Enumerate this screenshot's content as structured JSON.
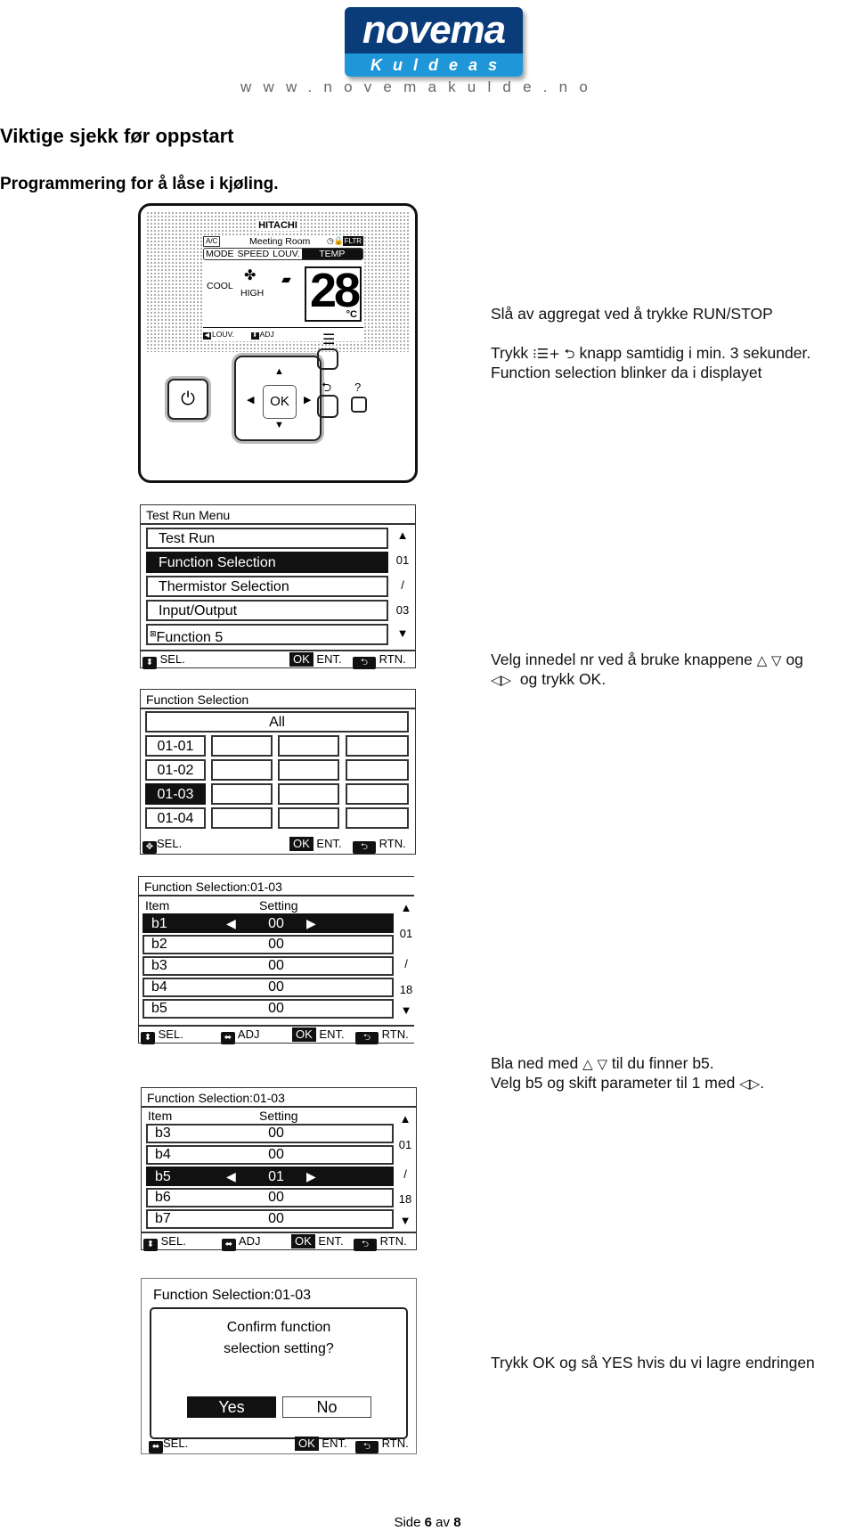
{
  "logo": {
    "brand": "novema",
    "sub": "Kuldeas",
    "url": "www.novemakulde.no",
    "colors": {
      "dark_blue": "#0b3c7a",
      "light_blue": "#1e96d8"
    }
  },
  "heading": "Viktige sjekk før oppstart",
  "subheading": "Programmering for å låse i kjøling.",
  "instructions": {
    "step1_line1": "Slå av aggregat ved å trykke RUN/STOP",
    "step1_line2_pre": "Trykk",
    "step1_line2_icons": "⁝☰+ ⮌",
    "step1_line2_post": "knapp samtidig i min. 3 sekunder.",
    "step1_line3": "Function selection blinker da i displayet",
    "step2_line1_pre": "Velg innedel nr ved å bruke knappene",
    "step2_updown": "△ ▽",
    "step2_line1_post": "og",
    "step2_leftright": "◁▷",
    "step2_line2_post": "og trykk OK.",
    "step3_line1_pre": "Bla ned med",
    "step3_updown": "△ ▽",
    "step3_line1_post": "til du finner b5.",
    "step3_line2_pre": "Velg b5 og skift parameter til 1 med",
    "step3_leftright": "◁▷",
    "step3_line2_post": ".",
    "step4": "Trykk OK og så YES hvis du vi lagre endringen"
  },
  "remote": {
    "brand": "HITACHI",
    "ac_tag": "A/C",
    "room": "Meeting Room",
    "filter_tag": "FLTR",
    "tabs": [
      "MODE",
      "SPEED",
      "LOUV.",
      "TEMP"
    ],
    "active_tab": "TEMP",
    "mode": "COOL",
    "speed": "HIGH",
    "temperature": "28",
    "unit": "°C",
    "footer_left": "LOUV.",
    "footer_right": "ADJ",
    "ok_label": "OK",
    "help_label": "?"
  },
  "screen_test_run": {
    "title": "Test Run Menu",
    "items": [
      "Test Run",
      "Function Selection",
      "Thermistor Selection",
      "Input/Output",
      "Function 5"
    ],
    "selected_index": 1,
    "page_current": "01",
    "page_sep": "/",
    "page_total": "03",
    "footer": {
      "sel": "SEL.",
      "ok": "OK",
      "ent": "ENT.",
      "rtn": "RTN."
    }
  },
  "screen_function_selection": {
    "title": "Function Selection",
    "all_label": "All",
    "units": [
      "01-01",
      "01-02",
      "01-03",
      "01-04"
    ],
    "selected_index": 2,
    "footer": {
      "sel": "SEL.",
      "ok": "OK",
      "ent": "ENT.",
      "rtn": "RTN."
    }
  },
  "screen_settings_a": {
    "title": "Function Selection:01-03",
    "col_item": "Item",
    "col_setting": "Setting",
    "rows": [
      {
        "item": "b1",
        "value": "00"
      },
      {
        "item": "b2",
        "value": "00"
      },
      {
        "item": "b3",
        "value": "00"
      },
      {
        "item": "b4",
        "value": "00"
      },
      {
        "item": "b5",
        "value": "00"
      }
    ],
    "selected_index": 0,
    "page_current": "01",
    "page_sep": "/",
    "page_total": "18",
    "footer": {
      "sel": "SEL.",
      "adj": "ADJ",
      "ok": "OK",
      "ent": "ENT.",
      "rtn": "RTN."
    }
  },
  "screen_settings_b": {
    "title": "Function Selection:01-03",
    "col_item": "Item",
    "col_setting": "Setting",
    "rows": [
      {
        "item": "b3",
        "value": "00"
      },
      {
        "item": "b4",
        "value": "00"
      },
      {
        "item": "b5",
        "value": "01"
      },
      {
        "item": "b6",
        "value": "00"
      },
      {
        "item": "b7",
        "value": "00"
      }
    ],
    "selected_index": 2,
    "page_current": "01",
    "page_sep": "/",
    "page_total": "18",
    "footer": {
      "sel": "SEL.",
      "adj": "ADJ",
      "ok": "OK",
      "ent": "ENT.",
      "rtn": "RTN."
    }
  },
  "screen_confirm": {
    "title": "Function Selection:01-03",
    "message_line1": "Confirm function",
    "message_line2": "selection setting?",
    "yes_label": "Yes",
    "no_label": "No",
    "selected": "Yes",
    "footer": {
      "sel": "SEL.",
      "ok": "OK",
      "ent": "ENT.",
      "rtn": "RTN."
    }
  },
  "footer": {
    "prefix": "Side",
    "page": "6",
    "mid": "av",
    "total": "8"
  }
}
